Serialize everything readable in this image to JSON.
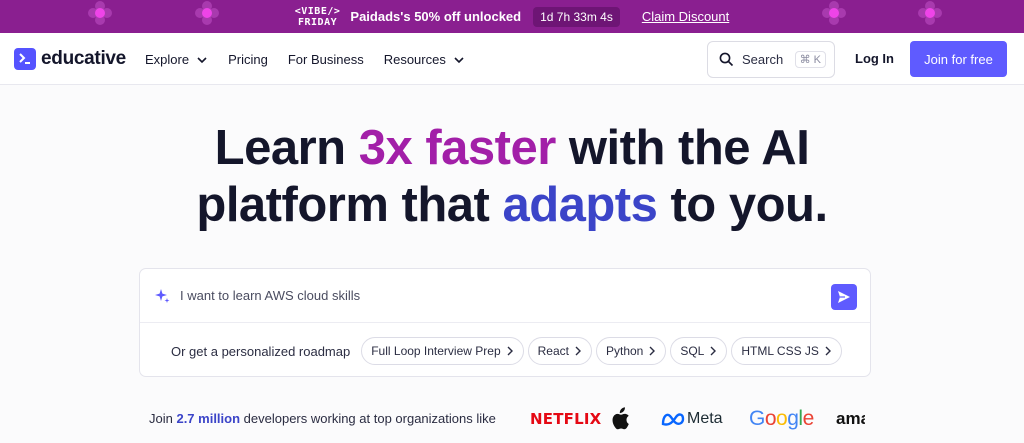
{
  "promo": {
    "badge_line1": "VIBE",
    "badge_line2": "FRIDAY",
    "text": "Paidads's 50% off unlocked",
    "timer": "1d 7h 33m 4s",
    "cta": "Claim Discount"
  },
  "header": {
    "logo_text": "educative",
    "nav": [
      "Explore",
      "Pricing",
      "For Business",
      "Resources"
    ],
    "search_label": "Search",
    "search_shortcut": "⌘ K",
    "login": "Log In",
    "join": "Join for free"
  },
  "hero": {
    "line1_a": "Learn ",
    "line1_highlight": "3x faster",
    "line1_b": " with the AI",
    "line2_a": "platform that ",
    "line2_highlight": "adapts",
    "line2_b": " to you."
  },
  "prompt": {
    "value": "I want to learn AWS cloud skills",
    "roadmap_label": "Or get a personalized roadmap",
    "chips": [
      "Full Loop Interview Prep",
      "React",
      "Python",
      "SQL",
      "HTML CSS JS"
    ]
  },
  "proof": {
    "prefix": "Join ",
    "number": "2.7 million",
    "suffix": " developers working at top organizations like",
    "brands": [
      "NETFLIX",
      "Meta",
      "Google",
      "ama"
    ]
  },
  "colors": {
    "promo_bg": "#8a1f90",
    "accent": "#5f5bff",
    "highlight_purple": "#a21fa8",
    "highlight_blue": "#3b44c8"
  },
  "icons": [
    "flower-icon",
    "logo-mark-icon",
    "chevron-down-icon",
    "search-icon",
    "sparkle-icon",
    "send-icon",
    "chevron-right-icon",
    "apple-icon"
  ]
}
